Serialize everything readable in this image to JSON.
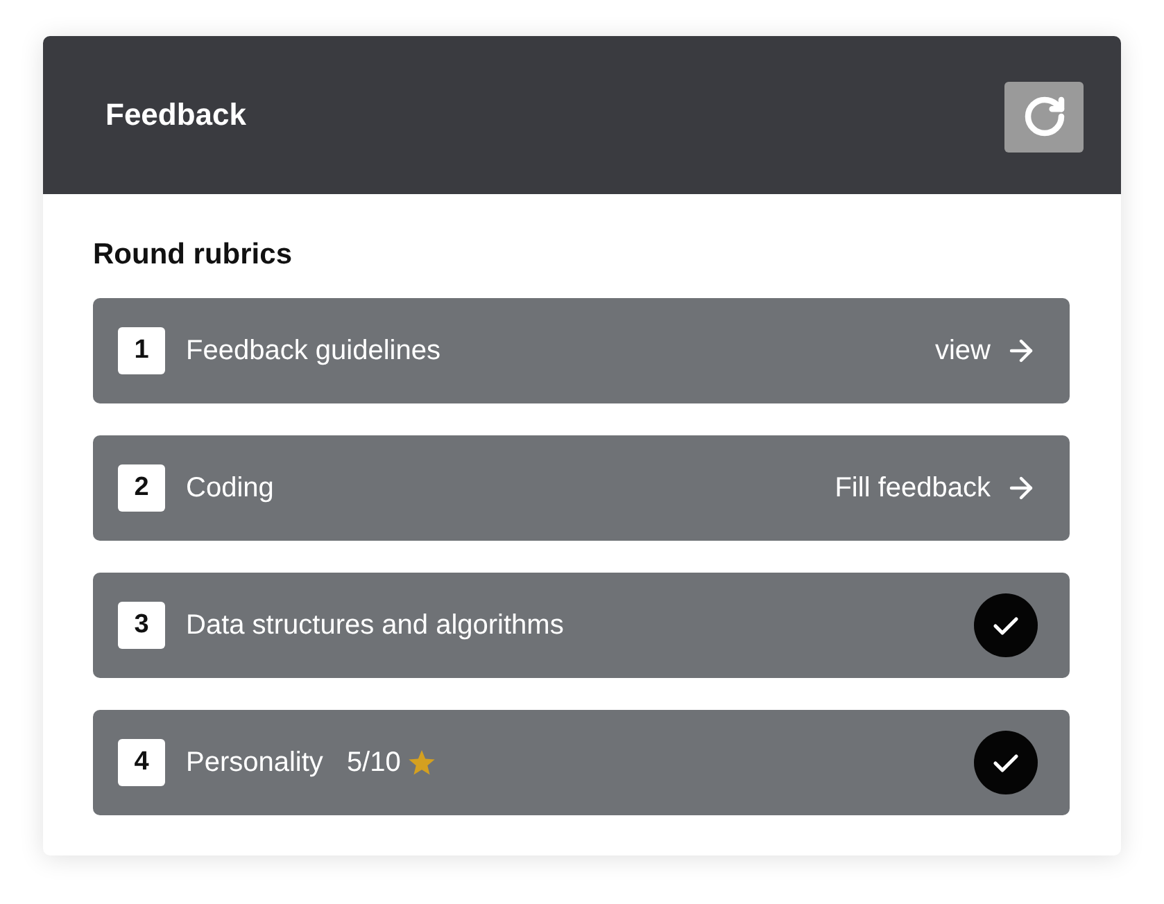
{
  "header": {
    "title": "Feedback"
  },
  "section": {
    "title": "Round rubrics"
  },
  "rubrics": [
    {
      "number": "1",
      "label": "Feedback guidelines",
      "completed": false,
      "action": "view"
    },
    {
      "number": "2",
      "label": "Coding",
      "completed": false,
      "action": "Fill feedback"
    },
    {
      "number": "3",
      "label": "Data structures and algorithms",
      "completed": true
    },
    {
      "number": "4",
      "label": "Personality",
      "score": "5/10",
      "completed": true
    }
  ]
}
